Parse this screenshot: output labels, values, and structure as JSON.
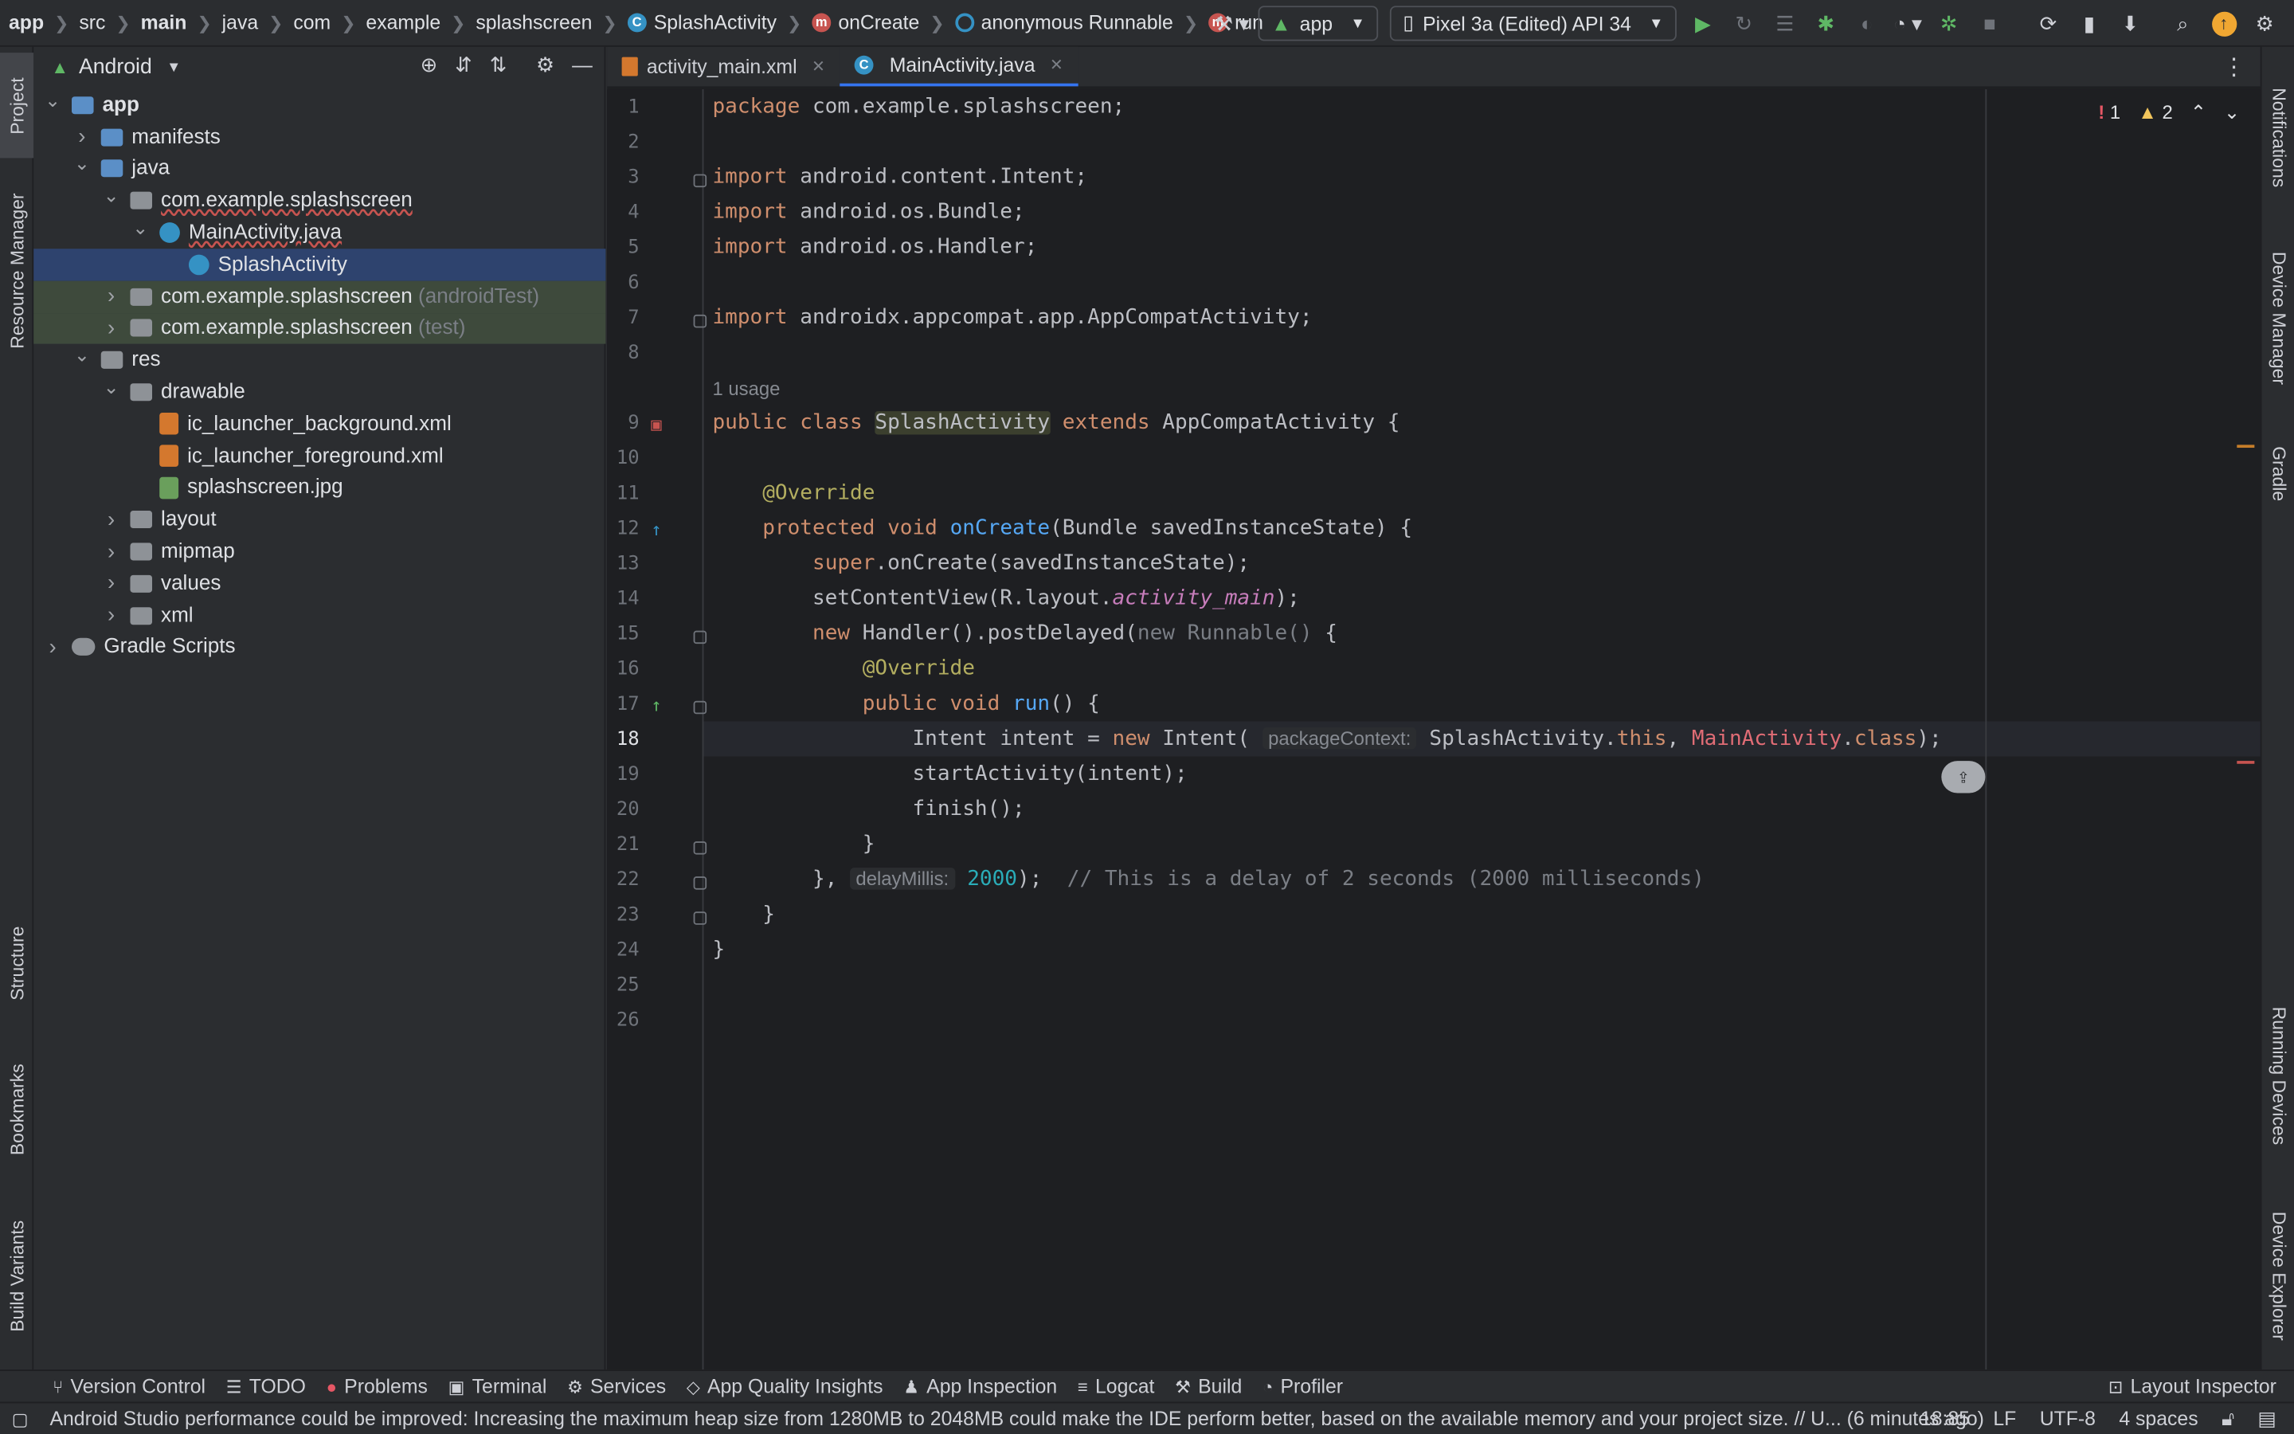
{
  "breadcrumbs": [
    {
      "label": "app",
      "bold": true,
      "icon": ""
    },
    {
      "label": "src",
      "bold": false,
      "icon": ""
    },
    {
      "label": "main",
      "bold": true,
      "icon": ""
    },
    {
      "label": "java",
      "bold": false,
      "icon": ""
    },
    {
      "label": "com",
      "bold": false,
      "icon": ""
    },
    {
      "label": "example",
      "bold": false,
      "icon": ""
    },
    {
      "label": "splashscreen",
      "bold": false,
      "icon": ""
    },
    {
      "label": "SplashActivity",
      "bold": false,
      "icon": "class-icon"
    },
    {
      "label": "onCreate",
      "bold": false,
      "icon": "method-icon"
    },
    {
      "label": "anonymous Runnable",
      "bold": false,
      "icon": "runnable-icon"
    },
    {
      "label": "run",
      "bold": false,
      "icon": "method-icon"
    }
  ],
  "toolbar": {
    "config": "app",
    "device": "Pixel 3a (Edited) API 34"
  },
  "left_tools": {
    "project": "Project",
    "resource_manager": "Resource Manager",
    "structure": "Structure",
    "bookmarks": "Bookmarks",
    "build_variants": "Build Variants"
  },
  "right_tools": {
    "notifications": "Notifications",
    "device_manager": "Device Manager",
    "gradle": "Gradle",
    "running_devices": "Running Devices",
    "device_explorer": "Device Explorer"
  },
  "project_panel": {
    "view": "Android",
    "tree": [
      {
        "label": "app",
        "dim": "",
        "depth": 0,
        "arrow": "v",
        "icon": "mod",
        "sel": false,
        "test": false,
        "bold": true
      },
      {
        "label": "manifests",
        "dim": "",
        "depth": 1,
        "arrow": ">",
        "icon": "blue",
        "sel": false,
        "test": false
      },
      {
        "label": "java",
        "dim": "",
        "depth": 1,
        "arrow": "v",
        "icon": "blue",
        "sel": false,
        "test": false
      },
      {
        "label": "com.example.splashscreen",
        "dim": "",
        "depth": 2,
        "arrow": "v",
        "icon": "pkg",
        "sel": false,
        "test": false,
        "wavy": true
      },
      {
        "label": "MainActivity.java",
        "dim": "",
        "depth": 3,
        "arrow": "v",
        "icon": "cls",
        "sel": false,
        "test": false,
        "wavy": true
      },
      {
        "label": "SplashActivity",
        "dim": "",
        "depth": 4,
        "arrow": "",
        "icon": "cls",
        "sel": true,
        "test": false
      },
      {
        "label": "com.example.splashscreen",
        "dim": "(androidTest)",
        "depth": 2,
        "arrow": ">",
        "icon": "pkg",
        "sel": false,
        "test": true
      },
      {
        "label": "com.example.splashscreen",
        "dim": "(test)",
        "depth": 2,
        "arrow": ">",
        "icon": "pkg",
        "sel": false,
        "test": true
      },
      {
        "label": "res",
        "dim": "",
        "depth": 1,
        "arrow": "v",
        "icon": "res",
        "sel": false,
        "test": false
      },
      {
        "label": "drawable",
        "dim": "",
        "depth": 2,
        "arrow": "v",
        "icon": "gray",
        "sel": false,
        "test": false
      },
      {
        "label": "ic_launcher_background.xml",
        "dim": "",
        "depth": 3,
        "arrow": "",
        "icon": "xml",
        "sel": false,
        "test": false
      },
      {
        "label": "ic_launcher_foreground.xml",
        "dim": "",
        "depth": 3,
        "arrow": "",
        "icon": "xml",
        "sel": false,
        "test": false
      },
      {
        "label": "splashscreen.jpg",
        "dim": "",
        "depth": 3,
        "arrow": "",
        "icon": "img",
        "sel": false,
        "test": false
      },
      {
        "label": "layout",
        "dim": "",
        "depth": 2,
        "arrow": ">",
        "icon": "gray",
        "sel": false,
        "test": false
      },
      {
        "label": "mipmap",
        "dim": "",
        "depth": 2,
        "arrow": ">",
        "icon": "gray",
        "sel": false,
        "test": false
      },
      {
        "label": "values",
        "dim": "",
        "depth": 2,
        "arrow": ">",
        "icon": "gray",
        "sel": false,
        "test": false
      },
      {
        "label": "xml",
        "dim": "",
        "depth": 2,
        "arrow": ">",
        "icon": "gray",
        "sel": false,
        "test": false
      },
      {
        "label": "Gradle Scripts",
        "dim": "",
        "depth": 0,
        "arrow": ">",
        "icon": "gradle",
        "sel": false,
        "test": false
      }
    ]
  },
  "editor": {
    "tabs": [
      {
        "label": "activity_main.xml",
        "active": false
      },
      {
        "label": "MainActivity.java",
        "active": true
      }
    ],
    "problems": {
      "errors": "1",
      "warnings": "2"
    },
    "usage_hint": "1 usage",
    "lines": [
      {
        "n": "1",
        "html": "<span class=\"kw\">package</span> com.example.splashscreen;"
      },
      {
        "n": "2",
        "html": ""
      },
      {
        "n": "3",
        "html": "<span class=\"kw\">import</span> android.content.Intent;"
      },
      {
        "n": "4",
        "html": "<span class=\"kw\">import</span> android.os.Bundle;"
      },
      {
        "n": "5",
        "html": "<span class=\"kw\">import</span> android.os.Handler;"
      },
      {
        "n": "6",
        "html": ""
      },
      {
        "n": "7",
        "html": "<span class=\"kw\">import</span> androidx.appcompat.app.AppCompatActivity;"
      },
      {
        "n": "8",
        "html": ""
      },
      {
        "n": "9",
        "html": "<span class=\"kw\">public class</span> <span class=\"hl\">SplashActivity</span> <span class=\"kw\">extends</span> AppCompatActivity {"
      },
      {
        "n": "10",
        "html": ""
      },
      {
        "n": "11",
        "html": "    <span class=\"ann\">@Override</span>"
      },
      {
        "n": "12",
        "html": "    <span class=\"kw\">protected void</span> <span class=\"fn\">onCreate</span>(Bundle savedInstanceState) {"
      },
      {
        "n": "13",
        "html": "        <span class=\"kw\">super</span>.onCreate(savedInstanceState);"
      },
      {
        "n": "14",
        "html": "        setContentView(R.layout.<span class=\"it\">activity_main</span>);"
      },
      {
        "n": "15",
        "html": "        <span class=\"kw\">new</span> Handler().postDelayed(<span class=\"cmt\">new Runnable()</span> {"
      },
      {
        "n": "16",
        "html": "            <span class=\"ann\">@Override</span>"
      },
      {
        "n": "17",
        "html": "            <span class=\"kw\">public void</span> <span class=\"fn\">run</span>() {"
      },
      {
        "n": "18",
        "html": "                Intent intent = <span class=\"kw\">new</span> Intent( <span class=\"hint\">packageContext:</span> SplashActivity.<span class=\"kw\">this</span>, <span style=\"color:#e06c75\">MainActivity</span>.<span class=\"kw\">class</span>);"
      },
      {
        "n": "19",
        "html": "                startActivity(intent);"
      },
      {
        "n": "20",
        "html": "                finish();"
      },
      {
        "n": "21",
        "html": "            }"
      },
      {
        "n": "22",
        "html": "        }, <span class=\"hint\">delayMillis:</span> <span class=\"num\">2000</span>);  <span class=\"cmt\">// This is a delay of 2 seconds (2000 milliseconds)</span>"
      },
      {
        "n": "23",
        "html": "    }"
      },
      {
        "n": "24",
        "html": "}"
      },
      {
        "n": "25",
        "html": ""
      },
      {
        "n": "26",
        "html": ""
      }
    ]
  },
  "bottom_tools": [
    {
      "label": "Version Control",
      "icon": "branch-icon"
    },
    {
      "label": "TODO",
      "icon": "list-icon"
    },
    {
      "label": "Problems",
      "icon": "error-icon"
    },
    {
      "label": "Terminal",
      "icon": "terminal-icon"
    },
    {
      "label": "Services",
      "icon": "services-icon"
    },
    {
      "label": "App Quality Insights",
      "icon": "diamond-icon"
    },
    {
      "label": "App Inspection",
      "icon": "inspection-icon"
    },
    {
      "label": "Logcat",
      "icon": "logcat-icon"
    },
    {
      "label": "Build",
      "icon": "hammer-icon"
    },
    {
      "label": "Profiler",
      "icon": "gauge-icon"
    }
  ],
  "layout_inspector": "Layout Inspector",
  "status": {
    "message": "Android Studio performance could be improved: Increasing the maximum heap size from 1280MB to 2048MB could make the IDE perform better, based on the available memory and your project size. // U... (6 minutes ago)",
    "position": "18:85",
    "line_sep": "LF",
    "encoding": "UTF-8",
    "indent": "4 spaces"
  }
}
